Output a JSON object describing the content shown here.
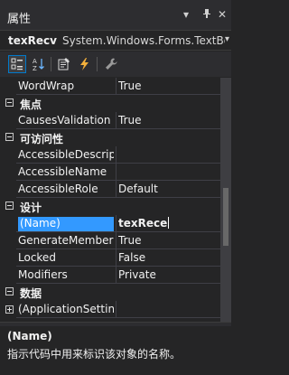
{
  "window": {
    "title": "属性",
    "buttons": [
      "▾",
      "ᵖ",
      "✕"
    ]
  },
  "object": {
    "name": "texRecv",
    "type": "System.Windows.Forms.TextBo:",
    "dropdown_icon": "chevron-down-icon"
  },
  "toolbar": {
    "buttons": [
      {
        "name": "categorized-view-button",
        "icon": "categorized-icon",
        "active": true
      },
      {
        "name": "alphabetical-view-button",
        "icon": "sort-az-icon",
        "active": false
      },
      {
        "name": "properties-view-button",
        "icon": "properties-icon",
        "active": false
      },
      {
        "name": "events-view-button",
        "icon": "lightning-icon",
        "active": false
      },
      {
        "name": "property-pages-button",
        "icon": "wrench-icon",
        "active": false
      }
    ]
  },
  "grid": {
    "rows": [
      {
        "kind": "prop",
        "name": "WordWrap",
        "value": "True"
      },
      {
        "kind": "category",
        "label": "焦点",
        "expanded": true
      },
      {
        "kind": "prop",
        "name": "CausesValidation",
        "value": "True"
      },
      {
        "kind": "category",
        "label": "可访问性",
        "expanded": true
      },
      {
        "kind": "prop",
        "name": "AccessibleDescrip",
        "value": ""
      },
      {
        "kind": "prop",
        "name": "AccessibleName",
        "value": ""
      },
      {
        "kind": "prop",
        "name": "AccessibleRole",
        "value": "Default"
      },
      {
        "kind": "category",
        "label": "设计",
        "expanded": true
      },
      {
        "kind": "prop",
        "name": "(Name)",
        "value": "texRece",
        "selected": true
      },
      {
        "kind": "prop",
        "name": "GenerateMember",
        "value": "True"
      },
      {
        "kind": "prop",
        "name": "Locked",
        "value": "False"
      },
      {
        "kind": "prop",
        "name": "Modifiers",
        "value": "Private"
      },
      {
        "kind": "category",
        "label": "数据",
        "expanded": true
      },
      {
        "kind": "prop",
        "name": "(ApplicationSettin",
        "value": "",
        "expandable": true
      }
    ]
  },
  "description": {
    "title": "(Name)",
    "text": "指示代码中用来标识该对象的名称。"
  },
  "colors": {
    "background": "#252526",
    "selection": "#3399ff",
    "accent": "#007acc"
  }
}
